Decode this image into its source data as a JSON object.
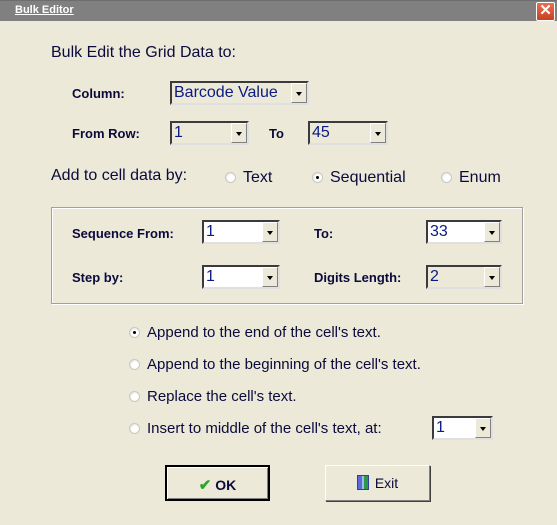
{
  "window": {
    "title": "Bulk Editor",
    "close_label": "✕"
  },
  "heading": "Bulk Edit the Grid Data to:",
  "column": {
    "label": "Column:",
    "value": "Barcode Value"
  },
  "rows": {
    "from_label": "From Row:",
    "from_value": "1",
    "to_label": "To",
    "to_value": "45"
  },
  "mode": {
    "label": "Add to cell data by:",
    "options": [
      {
        "label": "Text",
        "selected": false
      },
      {
        "label": "Sequential",
        "selected": true
      },
      {
        "label": "Enum",
        "selected": false
      }
    ]
  },
  "sequence": {
    "from_label": "Sequence From:",
    "from_value": "1",
    "to_label": "To:",
    "to_value": "33",
    "step_label": "Step by:",
    "step_value": "1",
    "digits_label": "Digits Length:",
    "digits_value": "2"
  },
  "placement": {
    "options": [
      {
        "label": "Append to the end of the cell's text.",
        "selected": true
      },
      {
        "label": "Append to the beginning of the cell's text.",
        "selected": false
      },
      {
        "label": "Replace the cell's text.",
        "selected": false
      },
      {
        "label": "Insert to middle of the cell's text, at:",
        "selected": false
      }
    ],
    "insert_position": "1"
  },
  "buttons": {
    "ok_label": "OK",
    "ok_icon": "✔",
    "exit_label": "Exit"
  }
}
